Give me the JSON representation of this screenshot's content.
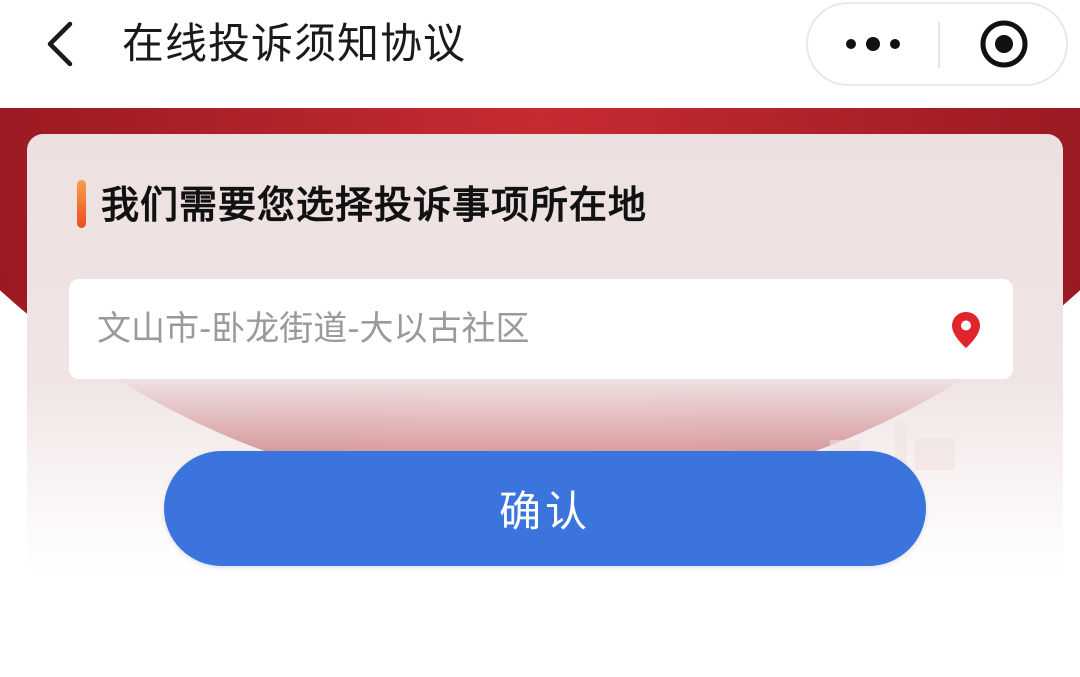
{
  "navbar": {
    "title": "在线投诉须知协议",
    "back_icon": "chevron-left-icon",
    "more_icon": "more-dots-icon",
    "close_icon": "target-circle-icon"
  },
  "card": {
    "title": "我们需要您选择投诉事项所在地",
    "location_value": "文山市-卧龙街道-大以古社区",
    "location_icon": "map-pin-icon"
  },
  "confirm_label": "确认",
  "colors": {
    "banner_red": "#9d1b22",
    "accent_orange": "#ec4d21",
    "button_blue": "#3a74dc",
    "pin_red": "#e0262c"
  }
}
